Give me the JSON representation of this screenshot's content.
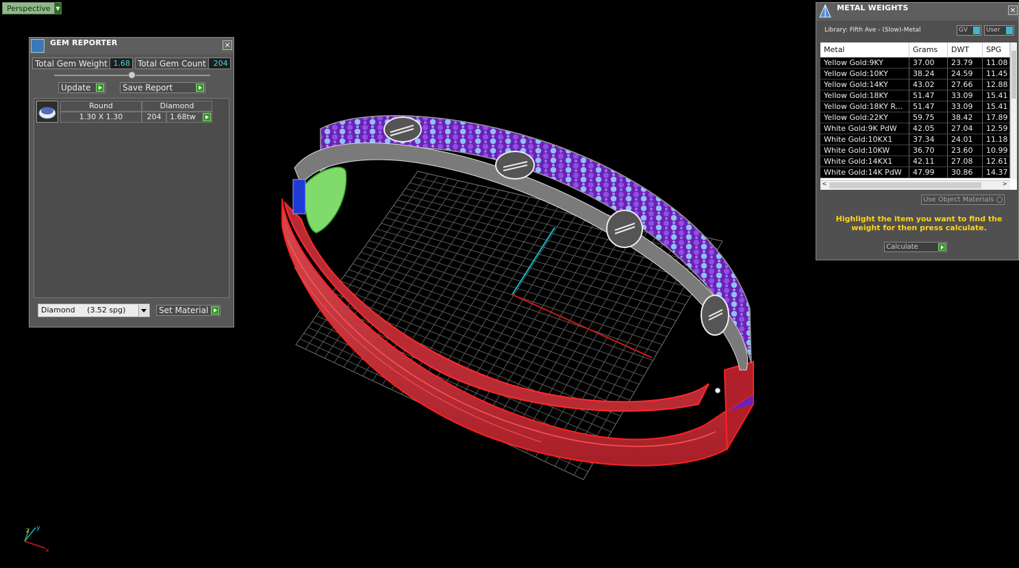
{
  "viewport": {
    "label": "Perspective"
  },
  "gem_reporter": {
    "title": "GEM REPORTER",
    "close_glyph": "×",
    "total_weight_label": "Total Gem Weight",
    "total_weight_value": "1.68",
    "total_count_label": "Total Gem Count",
    "total_count_value": "204",
    "update_label": "Update",
    "save_report_label": "Save Report",
    "gems": [
      {
        "shape": "Round",
        "material": "Diamond",
        "size": "1.30 X 1.30",
        "count": "204",
        "weight": "1.68tw"
      }
    ],
    "material_select": "Diamond     (3.52 spg)",
    "set_material_label": "Set Material"
  },
  "metal_weights": {
    "title": "METAL WEIGHTS",
    "close_glyph": "×",
    "library_label": "Library: Fifth Ave - (Slow)-Metal",
    "gv_label": "GV",
    "user_label": "User",
    "columns": [
      "Metal",
      "Grams",
      "DWT",
      "SPG"
    ],
    "rows": [
      [
        "Yellow Gold:9KY",
        "37.00",
        "23.79",
        "11.08"
      ],
      [
        "Yellow Gold:10KY",
        "38.24",
        "24.59",
        "11.45"
      ],
      [
        "Yellow Gold:14KY",
        "43.02",
        "27.66",
        "12.88"
      ],
      [
        "Yellow Gold:18KY",
        "51.47",
        "33.09",
        "15.41"
      ],
      [
        "Yellow Gold:18KY R...",
        "51.47",
        "33.09",
        "15.41"
      ],
      [
        "Yellow Gold:22KY",
        "59.75",
        "38.42",
        "17.89"
      ],
      [
        "White Gold:9K PdW",
        "42.05",
        "27.04",
        "12.59"
      ],
      [
        "White Gold:10KX1",
        "37.34",
        "24.01",
        "11.18"
      ],
      [
        "White Gold:10KW",
        "36.70",
        "23.60",
        "10.99"
      ],
      [
        "White Gold:14KX1",
        "42.11",
        "27.08",
        "12.61"
      ],
      [
        "White Gold:14K PdW",
        "47.99",
        "30.86",
        "14.37"
      ]
    ],
    "use_object_materials_label": "Use Object Materials",
    "hint": "Highlight the item you want to find the weight for then press calculate.",
    "calculate_label": "Calculate"
  },
  "axis_labels": {
    "x": "x",
    "y": "y",
    "z": "z"
  },
  "colors": {
    "band": "#c8383f",
    "band_edge": "#ff2020",
    "pave_purple": "#7a2fc8",
    "pave_gem": "#7fb4f0",
    "grid": "#5a5a5a",
    "accent_cyan": "#46d8e6",
    "hint_yellow": "#ffd31a"
  }
}
